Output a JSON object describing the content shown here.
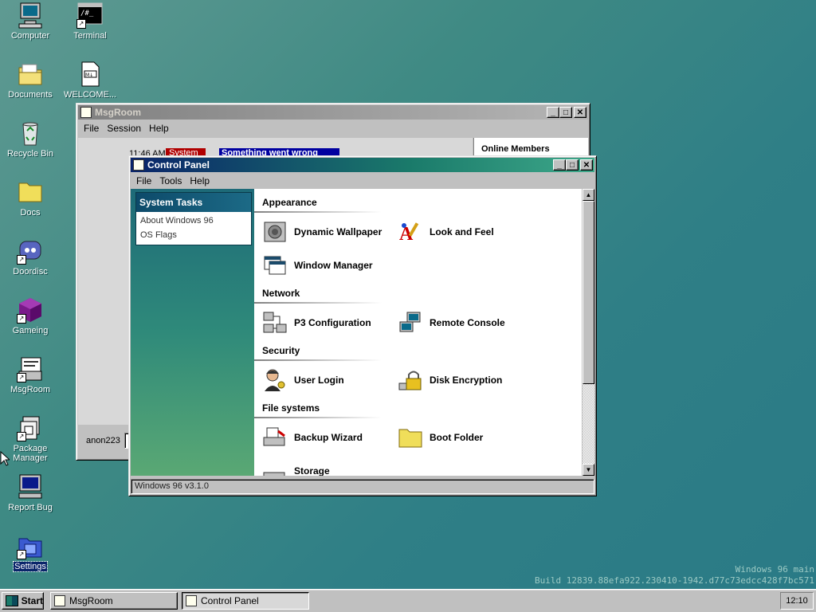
{
  "desktop": {
    "icons": [
      {
        "label": "Computer"
      },
      {
        "label": "Terminal"
      },
      {
        "label": "Documents"
      },
      {
        "label": "WELCOME..."
      },
      {
        "label": "Recycle Bin"
      },
      {
        "label": "Docs"
      },
      {
        "label": "Doordisc"
      },
      {
        "label": "Gameing"
      },
      {
        "label": "MsgRoom"
      },
      {
        "label": "Package Manager"
      },
      {
        "label": "Report Bug"
      },
      {
        "label": "Settings"
      }
    ],
    "watermark": {
      "line1": "Windows 96 main",
      "line2": "Build 12839.88efa922.230410-1942.d77c73edcc428f7bc571"
    }
  },
  "msgroom": {
    "title": "MsgRoom",
    "menu": [
      "File",
      "Session",
      "Help"
    ],
    "time": "11:46 AM",
    "sender": "System",
    "message": "Something went wrong",
    "members_title": "Online Members",
    "username": "anon223"
  },
  "control_panel": {
    "title": "Control Panel",
    "menu": [
      "File",
      "Tools",
      "Help"
    ],
    "tasks_header": "System Tasks",
    "tasks": [
      "About Windows 96",
      "OS Flags"
    ],
    "sections": {
      "appearance": "Appearance",
      "network": "Network",
      "security": "Security",
      "filesystems": "File systems"
    },
    "applets": {
      "dynamic_wallpaper": "Dynamic Wallpaper",
      "look_and_feel": "Look and Feel",
      "window_manager": "Window Manager",
      "p3_configuration": "P3 Configuration",
      "remote_console": "Remote Console",
      "user_login": "User Login",
      "disk_encryption": "Disk Encryption",
      "backup_wizard": "Backup Wizard",
      "boot_folder": "Boot Folder",
      "storage": "Storage"
    },
    "status": "Windows 96 v3.1.0"
  },
  "taskbar": {
    "start": "Start",
    "items": [
      "MsgRoom",
      "Control Panel"
    ],
    "clock": "12:10"
  },
  "colors": {
    "title_active": "#0a246a",
    "system_badge": "#b00000",
    "highlight": "#0000a0"
  }
}
